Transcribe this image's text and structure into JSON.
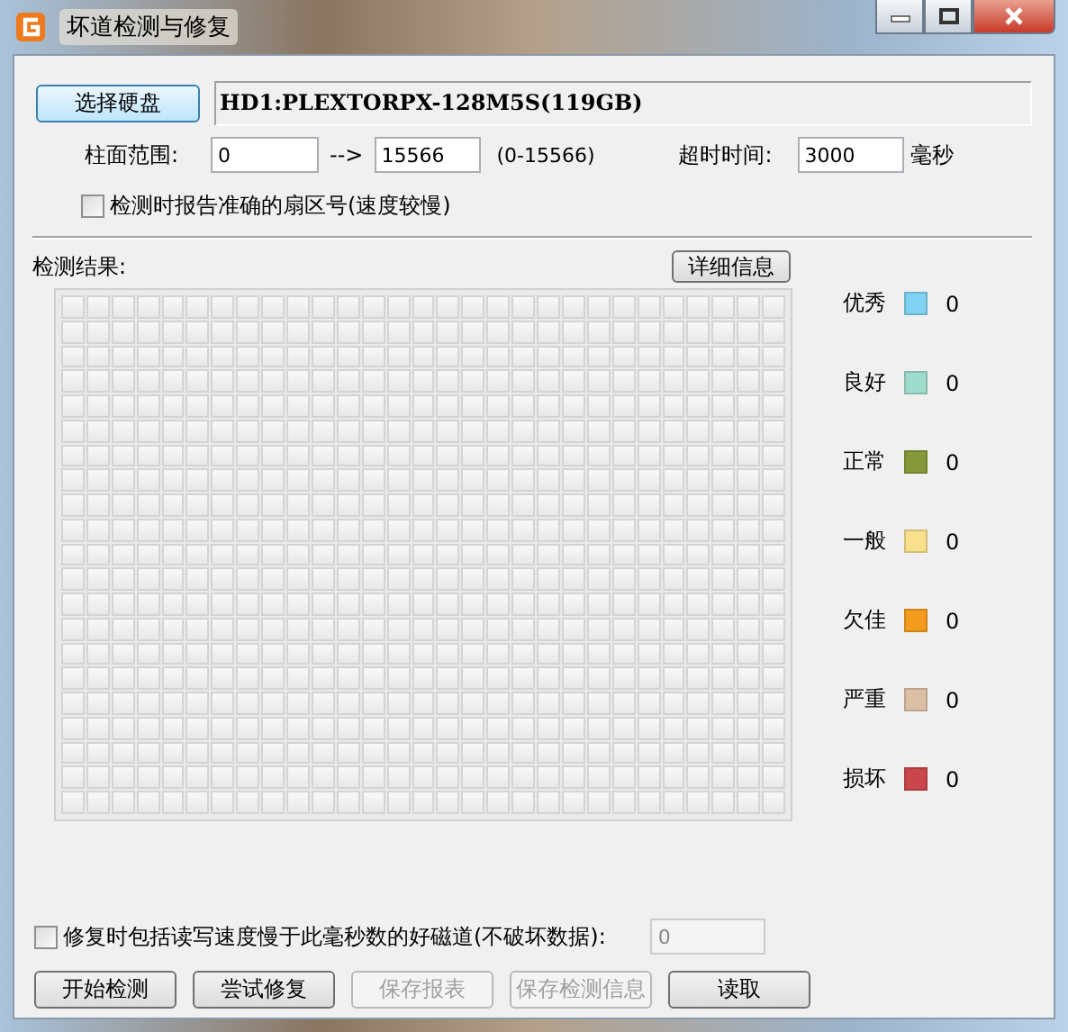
{
  "window": {
    "title": "坏道检测与修复"
  },
  "disk": {
    "button": "选择硬盘",
    "name": "HD1:PLEXTORPX-128M5S(119GB)"
  },
  "range": {
    "label": "柱面范围:",
    "from": "0",
    "arrow": "-->",
    "to": "15566",
    "hint": "(0-15566)"
  },
  "timeout": {
    "label": "超时时间:",
    "value": "3000",
    "unit": "毫秒"
  },
  "report_exact": {
    "label": "检测时报告准确的扇区号(速度较慢)",
    "checked": false
  },
  "results": {
    "label": "检测结果:",
    "details_button": "详细信息"
  },
  "legend": [
    {
      "label": "优秀",
      "color": "#7fd2f0",
      "count": "0"
    },
    {
      "label": "良好",
      "color": "#9fdcce",
      "count": "0"
    },
    {
      "label": "正常",
      "color": "#86993a",
      "count": "0"
    },
    {
      "label": "一般",
      "color": "#f8e08c",
      "count": "0"
    },
    {
      "label": "欠佳",
      "color": "#f29b1c",
      "count": "0"
    },
    {
      "label": "严重",
      "color": "#dcc0a6",
      "count": "0"
    },
    {
      "label": "损坏",
      "color": "#c9464a",
      "count": "0"
    }
  ],
  "repair_slow": {
    "label": "修复时包括读写速度慢于此毫秒数的好磁道(不破坏数据):",
    "checked": false,
    "value": "0",
    "disabled": true
  },
  "buttons": [
    {
      "label": "开始检测",
      "disabled": false
    },
    {
      "label": "尝试修复",
      "disabled": false
    },
    {
      "label": "保存报表",
      "disabled": true
    },
    {
      "label": "保存检测信息",
      "disabled": true
    },
    {
      "label": "读取",
      "disabled": false
    }
  ]
}
